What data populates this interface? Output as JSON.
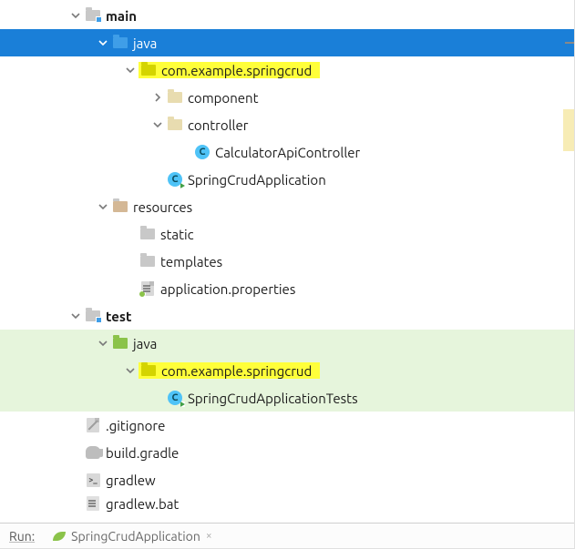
{
  "tree": {
    "main": {
      "label": "main",
      "java": {
        "label": "java",
        "pkg": {
          "label": "com.example.springcrud",
          "component": {
            "label": "component"
          },
          "controller": {
            "label": "controller",
            "calculator": {
              "label": "CalculatorApiController"
            }
          },
          "springCrudApp": {
            "label": "SpringCrudApplication"
          }
        }
      },
      "resources": {
        "label": "resources",
        "static": {
          "label": "static"
        },
        "templates": {
          "label": "templates"
        },
        "props": {
          "label": "application.properties"
        }
      }
    },
    "test": {
      "label": "test",
      "java": {
        "label": "java",
        "pkg": {
          "label": "com.example.springcrud",
          "tests": {
            "label": "SpringCrudApplicationTests"
          }
        }
      }
    },
    "files": {
      "gitignore": ".gitignore",
      "buildGradle": "build.gradle",
      "gradlew": "gradlew",
      "gradlewBat": "gradlew.bat"
    }
  },
  "bottom": {
    "runLabel": "Run:",
    "tabName": "SpringCrudApplication",
    "closeGlyph": "×"
  }
}
